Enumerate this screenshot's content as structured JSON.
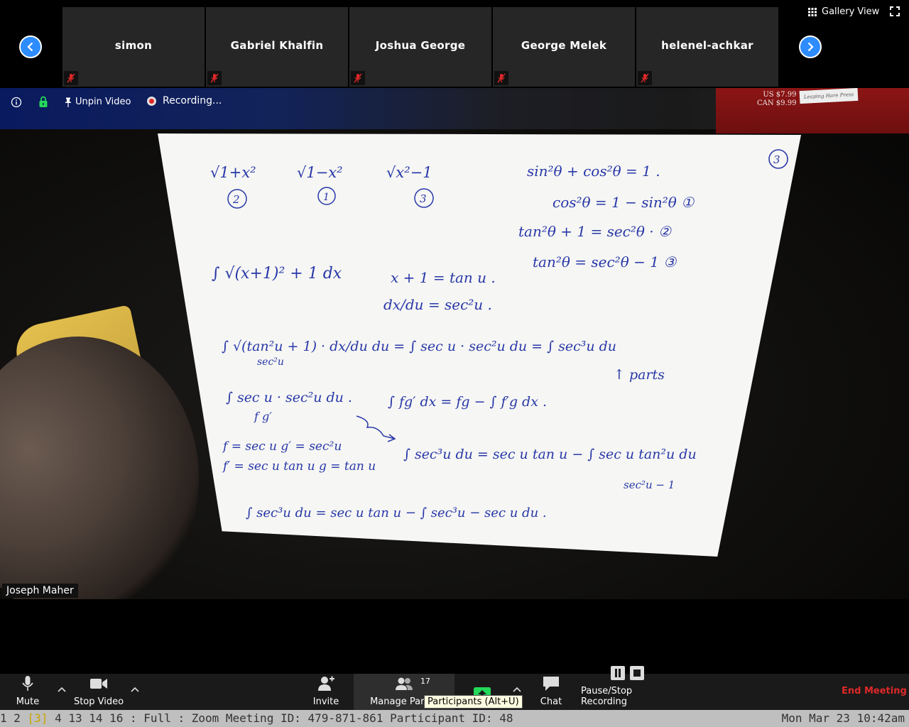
{
  "participants": [
    {
      "name": "simon"
    },
    {
      "name": "Gabriel Khalfin"
    },
    {
      "name": "Joshua George"
    },
    {
      "name": "George Melek"
    },
    {
      "name": "helenel-achkar"
    }
  ],
  "gallery_view_label": "Gallery View",
  "video_controls": {
    "unpin_label": "Unpin Video",
    "recording_label": "Recording..."
  },
  "speaker_name": "Joseph Maher",
  "book": {
    "price_us": "US $7.99",
    "price_can": "CAN $9.99",
    "sticker": "Leaping Hare Press"
  },
  "whiteboard": {
    "page_number": "3",
    "lines": [
      "√1+x²",
      "√1−x²",
      "√x²−1",
      "2",
      "1",
      "3",
      "sin²θ + cos²θ = 1 .",
      "cos²θ = 1 − sin²θ  ①",
      "tan²θ + 1 = sec²θ · ②",
      "tan²θ = sec²θ − 1  ③",
      "∫ √(x+1)² + 1  dx",
      "x + 1 = tan u .",
      "dx/du = sec²u .",
      "∫ √(tan²u + 1) · dx/du du = ∫ sec u · sec²u du = ∫ sec³u du",
      "sec²u",
      "↑ parts",
      "∫ sec u · sec²u du .",
      "f        g′",
      "∫ fg′ dx = fg − ∫ f′g dx .",
      "f = sec u     g′ = sec²u",
      "f′ = sec u tan u    g = tan u",
      "∫ sec³u du = sec u tan u − ∫ sec u tan²u du",
      "sec²u − 1",
      "∫ sec³u du = sec u tan u − ∫ sec³u − sec u du ."
    ]
  },
  "toolbar": {
    "mute_label": "Mute",
    "stop_video_label": "Stop Video",
    "invite_label": "Invite",
    "manage_participants_label": "Manage Partici",
    "participant_count": "17",
    "tooltip": "Participants (Alt+U)",
    "chat_label": "Chat",
    "recording_label": "Pause/Stop Recording",
    "end_meeting_label": "End Meeting"
  },
  "statusbar": {
    "windows_before": "1 2 ",
    "current_window": "[3]",
    "windows_after": " 4 13 14 16 : Full : Zoom Meeting ID: 479-871-861 Participant ID: 48",
    "datetime": "Mon Mar 23 10:42am"
  },
  "colors": {
    "accent_blue": "#2D8CFF",
    "end_meeting_red": "#E02828",
    "share_green": "#23D959",
    "ink_blue": "#2838A8"
  }
}
